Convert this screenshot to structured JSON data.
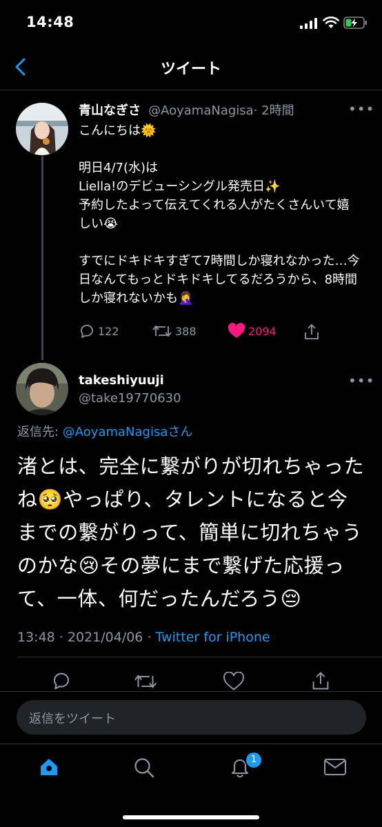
{
  "status_bar": {
    "time": "14:48"
  },
  "nav": {
    "title": "ツイート"
  },
  "tweet": {
    "name": "青山なぎさ",
    "handle": "@AoyamaNagisa",
    "time": "· 2時間",
    "text": "こんにちは🌞\n\n明日4/7(水)は\nLiella!のデビューシングル発売日✨\n予約したよって伝えてくれる人がたくさんいて嬉しい😭\n\nすでにドキドキすぎて7時間しか寝れなかった…今日なんてもっとドキドキしてるだろうから、8時間しか寝れないかも🤦‍♀️",
    "reply_count": "122",
    "retweet_count": "388",
    "like_count": "2094"
  },
  "reply": {
    "name": "takeshiyuuji",
    "handle": "@take19770630",
    "reply_to_prefix": "返信先: ",
    "reply_to_user": "@AoyamaNagisaさん",
    "text": "渚とは、完全に繋がりが切れちゃったね🥺やっぱり、タレントになると今までの繋がりって、簡単に切れちゃうのかな😢その夢にまで繋げた応援って、一体、何だったんだろう😔",
    "time": "13:48",
    "date": "2021/04/06",
    "source": "Twitter for iPhone"
  },
  "composer": {
    "placeholder": "返信をツイート"
  },
  "tabbar": {
    "notifications_badge": "1"
  },
  "colors": {
    "accent": "#1d9bf0",
    "like": "#f91880",
    "muted": "#8b98a5",
    "background": "#000000"
  }
}
